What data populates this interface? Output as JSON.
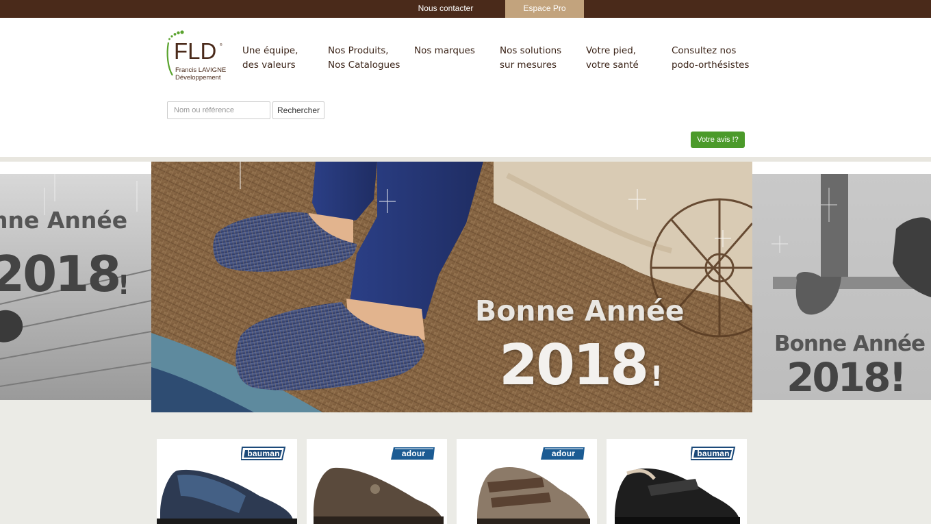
{
  "topbar": {
    "contact_label": "Nous contacter",
    "pro_label": "Espace Pro"
  },
  "logo": {
    "mark": "FLD",
    "line1": "Francis LAVIGNE",
    "line2": "Développement"
  },
  "nav": {
    "items": [
      {
        "label": "Une équipe,\ndes valeurs"
      },
      {
        "label": "Nos Produits,\nNos Catalogues"
      },
      {
        "label": "Nos marques"
      },
      {
        "label": "Nos solutions\nsur mesures"
      },
      {
        "label": "Votre pied,\nvotre santé"
      },
      {
        "label": "Consultez nos\npodo-orthésistes"
      }
    ]
  },
  "search": {
    "placeholder": "Nom ou référence",
    "button_label": "Rechercher"
  },
  "feedback": {
    "button_label": "Votre avis !?"
  },
  "carousel": {
    "main": {
      "line1": "Bonne Année",
      "line2": "2018",
      "mark": "!"
    },
    "left": {
      "line1": "nne Année",
      "line2": "2018",
      "mark": "!"
    },
    "right": {
      "line1": "Bonne Année",
      "line2": "2018!"
    }
  },
  "products": [
    {
      "brand": "bauman",
      "color": "#1c4a7a"
    },
    {
      "brand": "adour",
      "color": "#1b5b93"
    },
    {
      "brand": "adour",
      "color": "#1b5b93"
    },
    {
      "brand": "bauman",
      "color": "#1c4a7a"
    }
  ],
  "colors": {
    "topbar": "#4a2a1a",
    "pro_tab": "#c2a37d",
    "accent_green": "#4b9a2a",
    "text_brown": "#3b2418"
  }
}
